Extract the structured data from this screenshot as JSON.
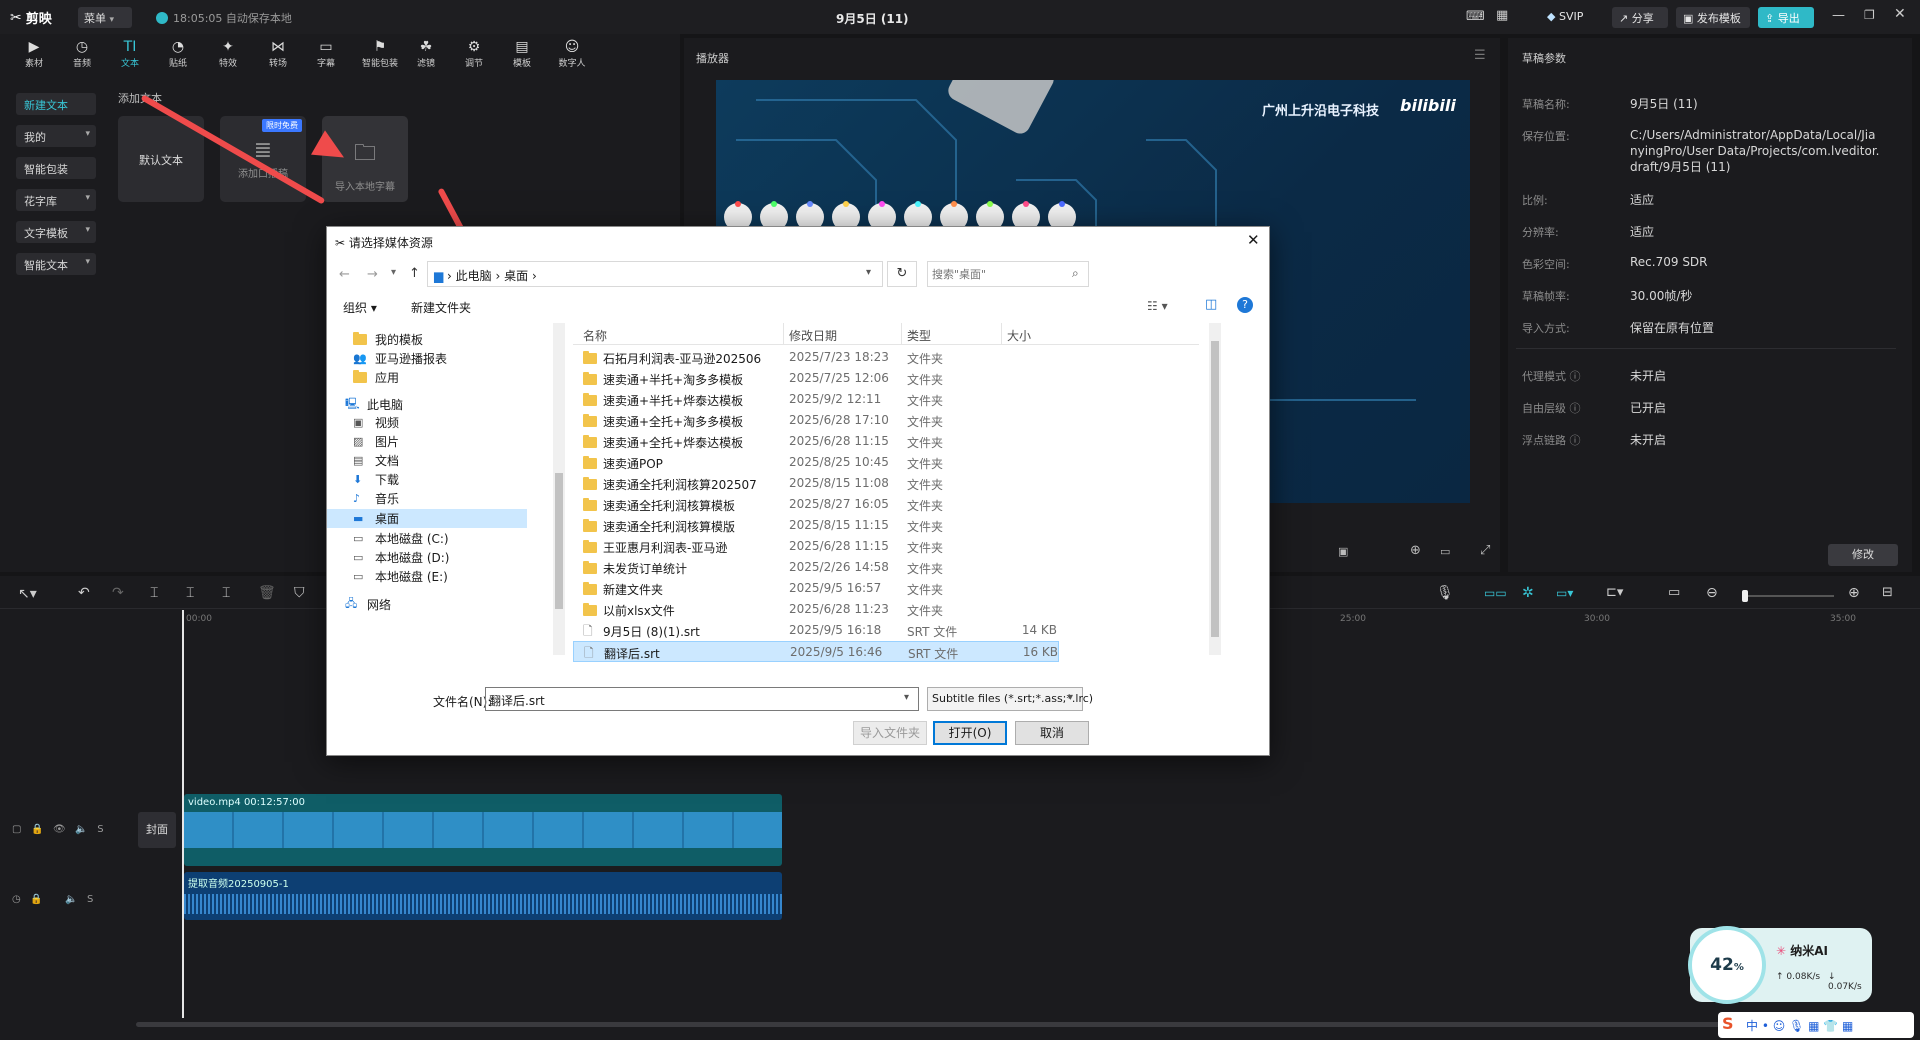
{
  "app": {
    "logo": "剪映",
    "menu_label": "菜单",
    "autosave": "18:05:05 自动保存本地",
    "title": "9月5日 (11)"
  },
  "titlebar_buttons": {
    "svip": "SVIP",
    "share": "分享",
    "publish_template": "发布模板",
    "export": "导出"
  },
  "toolbar": {
    "tools": [
      "素材",
      "音频",
      "文本",
      "贴纸",
      "特效",
      "转场",
      "字幕",
      "智能包装",
      "滤镜",
      "调节",
      "模板",
      "数字人"
    ]
  },
  "left_nav": [
    "新建文本",
    "我的",
    "花字库",
    "文字模板",
    "智能文本"
  ],
  "text_cards": {
    "section": "添加文本",
    "default": "默认文本",
    "add_narration": "添加口播稿",
    "import_local": "导入本地字幕",
    "badge": "限时免费"
  },
  "player": {
    "label": "播放器",
    "watermark": "广州上升沿电子科技",
    "bilibili": "bilibili"
  },
  "draft_params": {
    "title": "草稿参数",
    "items": [
      {
        "label": "草稿名称:",
        "value": "9月5日 (11)"
      },
      {
        "label": "保存位置:",
        "value": "C:/Users/Administrator/AppData/Local/JianyingPro/User Data/Projects/com.lveditor.draft/9月5日 (11)"
      },
      {
        "label": "比例:",
        "value": "适应"
      },
      {
        "label": "分辨率:",
        "value": "适应"
      },
      {
        "label": "色彩空间:",
        "value": "Rec.709 SDR"
      },
      {
        "label": "草稿帧率:",
        "value": "30.00帧/秒"
      },
      {
        "label": "导入方式:",
        "value": "保留在原有位置"
      },
      {
        "label": "代理模式",
        "value": "未开启"
      },
      {
        "label": "自由层级",
        "value": "已开启"
      },
      {
        "label": "浮点链路",
        "value": "未开启"
      }
    ],
    "edit_button": "修改"
  },
  "timeline": {
    "ticks": [
      "00:00",
      "25:00",
      "30:00",
      "35:00"
    ],
    "cover_label": "封面",
    "video_clip": "video.mp4  00:12:57:00",
    "audio_clip": "提取音频20250905-1"
  },
  "widget": {
    "percent": "42",
    "unit": "%",
    "name": "纳米AI",
    "up": "0.08K/s",
    "down": "0.07K/s"
  },
  "dialog": {
    "title": "请选择媒体资源",
    "path": [
      "此电脑",
      "桌面"
    ],
    "search_placeholder": "搜索\"桌面\"",
    "organize": "组织",
    "new_folder": "新建文件夹",
    "sidebar": [
      {
        "label": "我的模板",
        "icon": "folder-icon",
        "indent": 1
      },
      {
        "label": "亚马逊播报表",
        "icon": "people-icon",
        "indent": 1
      },
      {
        "label": "应用",
        "icon": "folder-icon",
        "indent": 1
      },
      {
        "label": "此电脑",
        "icon": "pc-icon",
        "indent": 0
      },
      {
        "label": "视频",
        "icon": "video-icon",
        "indent": 1
      },
      {
        "label": "图片",
        "icon": "image-icon",
        "indent": 1
      },
      {
        "label": "文档",
        "icon": "document-icon",
        "indent": 1
      },
      {
        "label": "下载",
        "icon": "download-icon",
        "indent": 1
      },
      {
        "label": "音乐",
        "icon": "music-icon",
        "indent": 1
      },
      {
        "label": "桌面",
        "icon": "desktop-icon",
        "indent": 1
      },
      {
        "label": "本地磁盘 (C:)",
        "icon": "drive-icon",
        "indent": 1
      },
      {
        "label": "本地磁盘 (D:)",
        "icon": "drive-icon",
        "indent": 1
      },
      {
        "label": "本地磁盘 (E:)",
        "icon": "drive-icon",
        "indent": 1
      },
      {
        "label": "网络",
        "icon": "network-icon",
        "indent": 0
      }
    ],
    "columns": {
      "name": "名称",
      "date": "修改日期",
      "type": "类型",
      "size": "大小"
    },
    "files": [
      {
        "name": "石拓月利润表-亚马逊202506",
        "date": "2025/7/23 18:23",
        "type": "文件夹",
        "size": ""
      },
      {
        "name": "速卖通+半托+淘多多模板",
        "date": "2025/7/25 12:06",
        "type": "文件夹",
        "size": ""
      },
      {
        "name": "速卖通+半托+烨泰达模板",
        "date": "2025/9/2 12:11",
        "type": "文件夹",
        "size": ""
      },
      {
        "name": "速卖通+全托+淘多多模板",
        "date": "2025/6/28 17:10",
        "type": "文件夹",
        "size": ""
      },
      {
        "name": "速卖通+全托+烨泰达模板",
        "date": "2025/6/28 11:15",
        "type": "文件夹",
        "size": ""
      },
      {
        "name": "速卖通POP",
        "date": "2025/8/25 10:45",
        "type": "文件夹",
        "size": ""
      },
      {
        "name": "速卖通全托利润核算202507",
        "date": "2025/8/15 11:08",
        "type": "文件夹",
        "size": ""
      },
      {
        "name": "速卖通全托利润核算模板",
        "date": "2025/8/27 16:05",
        "type": "文件夹",
        "size": ""
      },
      {
        "name": "速卖通全托利润核算模版",
        "date": "2025/8/15 11:15",
        "type": "文件夹",
        "size": ""
      },
      {
        "name": "王亚惠月利润表-亚马逊",
        "date": "2025/6/28 11:15",
        "type": "文件夹",
        "size": ""
      },
      {
        "name": "未发货订单统计",
        "date": "2025/2/26 14:58",
        "type": "文件夹",
        "size": ""
      },
      {
        "name": "新建文件夹",
        "date": "2025/9/5 16:57",
        "type": "文件夹",
        "size": ""
      },
      {
        "name": "以前xlsx文件",
        "date": "2025/6/28 11:23",
        "type": "文件夹",
        "size": ""
      },
      {
        "name": "9月5日 (8)(1).srt",
        "date": "2025/9/5 16:18",
        "type": "SRT 文件",
        "size": "14 KB"
      },
      {
        "name": "翻译后.srt",
        "date": "2025/9/5 16:46",
        "type": "SRT 文件",
        "size": "16 KB"
      }
    ],
    "filename_label": "文件名(N):",
    "filename_value": "翻译后.srt",
    "filter": "Subtitle files (*.srt;*.ass;*.lrc)",
    "import_folder": "导入文件夹",
    "open": "打开(O)",
    "cancel": "取消"
  },
  "colors": {
    "accent": "#38c6d6",
    "arrow": "#ef4b4b",
    "selection": "#cce8ff"
  }
}
